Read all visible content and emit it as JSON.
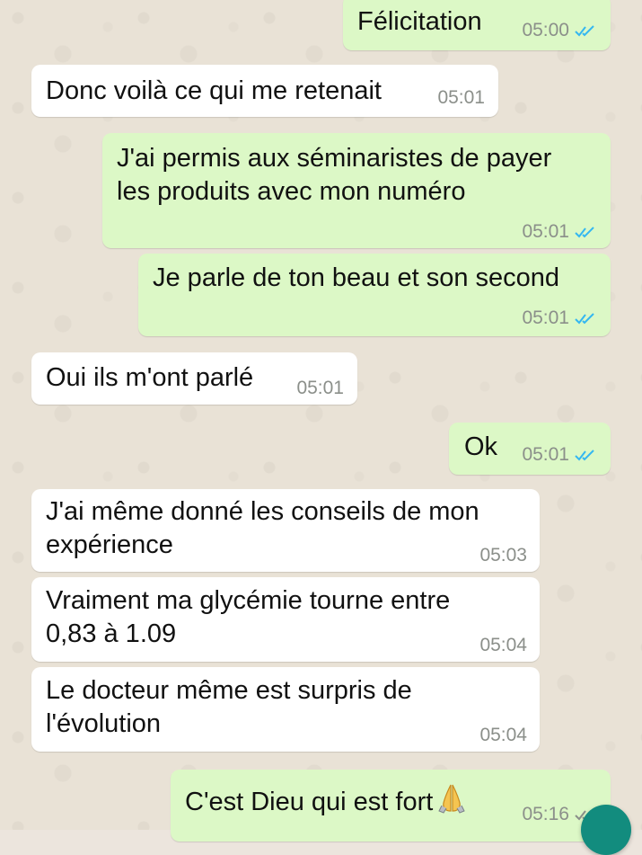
{
  "chat": {
    "messages": [
      {
        "direction": "out",
        "text": "Félicitation",
        "time": "05:00",
        "ticks": "read"
      },
      {
        "direction": "in",
        "text": "Donc voilà ce qui me retenait",
        "time": "05:01"
      },
      {
        "direction": "out",
        "text": "J'ai permis aux séminaristes de payer\nles produits avec mon numéro",
        "time": "05:01",
        "ticks": "read"
      },
      {
        "direction": "out",
        "text": "Je parle de ton beau et son second",
        "time": "05:01",
        "ticks": "read"
      },
      {
        "direction": "in",
        "text": "Oui ils m'ont parlé",
        "time": "05:01"
      },
      {
        "direction": "out",
        "text": "Ok",
        "time": "05:01",
        "ticks": "read"
      },
      {
        "direction": "in",
        "text": "J'ai même donné les conseils de mon\nexpérience",
        "time": "05:03"
      },
      {
        "direction": "in",
        "text": "Vraiment ma glycémie tourne entre\n0,83 à 1.09",
        "time": "05:04"
      },
      {
        "direction": "in",
        "text": "Le docteur même est surpris de\nl'évolution",
        "time": "05:04"
      },
      {
        "direction": "out",
        "text": "C'est Dieu qui est fort",
        "emoji": "folded-hands-emoji",
        "time": "05:16",
        "ticks": "read"
      }
    ]
  },
  "colors": {
    "incoming_bubble": "#ffffff",
    "outgoing_bubble": "#dcf8c6",
    "read_ticks": "#34b7f1",
    "timestamp": "#8b8f8a",
    "background": "#e9e2d6"
  }
}
